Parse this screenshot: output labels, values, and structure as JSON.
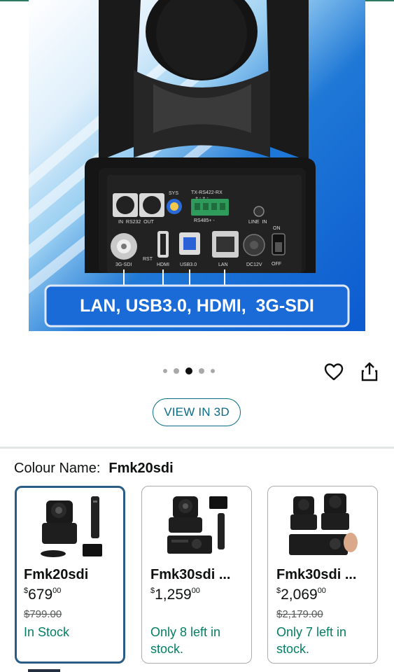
{
  "hero": {
    "banner_text": "LAN, USB3.0, HDMI,  3G-SDI",
    "ports": {
      "sys": "SYS",
      "tx": "TX-RS422-RX",
      "pm": "+ - + -",
      "rs485": "RS485+ -",
      "in_rs232_out": "IN  RS232  OUT",
      "line_in": "LINE  IN",
      "on": "ON",
      "off": "OFF",
      "sdi": "3G-SDI",
      "rst": "RST",
      "hdmi": "HDMI",
      "usb": "USB3.0",
      "lan": "LAN",
      "dc": "DC12V"
    }
  },
  "carousel": {
    "dot_count": 5,
    "active_index": 2
  },
  "actions": {
    "view3d_label": "VIEW IN 3D"
  },
  "colour": {
    "label": "Colour Name:",
    "value": "Fmk20sdi"
  },
  "variants": [
    {
      "name": "Fmk20sdi",
      "currency": "$",
      "price_whole": "679",
      "price_cents": "00",
      "was": "$799.00",
      "stock": "In Stock"
    },
    {
      "name": "Fmk30sdi ...",
      "currency": "$",
      "price_whole": "1,259",
      "price_cents": "00",
      "was": "",
      "stock": "Only 8 left in stock."
    },
    {
      "name": "Fmk30sdi ...",
      "currency": "$",
      "price_whole": "2,069",
      "price_cents": "00",
      "was": "$2,179.00",
      "stock": "Only 7 left in stock."
    }
  ],
  "colors": {
    "accent": "#0a6b86",
    "stock_green": "#067d62",
    "selected_border": "#2a5d86"
  }
}
